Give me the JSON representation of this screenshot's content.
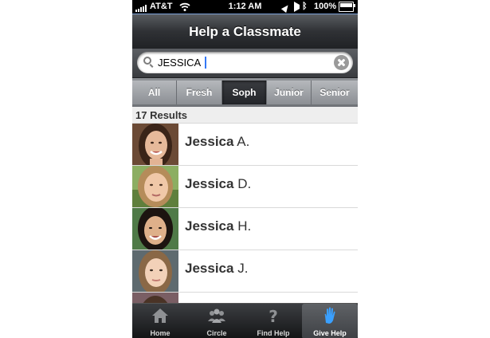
{
  "status_bar": {
    "carrier": "AT&T",
    "time": "1:12 AM",
    "battery_percent": "100%",
    "battery_level": 1.0
  },
  "nav": {
    "title": "Help a Classmate"
  },
  "search": {
    "value": "JESSICA",
    "placeholder": ""
  },
  "filters": [
    {
      "label": "All",
      "active": false
    },
    {
      "label": "Fresh",
      "active": false
    },
    {
      "label": "Soph",
      "active": true
    },
    {
      "label": "Junior",
      "active": false
    },
    {
      "label": "Senior",
      "active": false
    }
  ],
  "results": {
    "count_label": "17 Results",
    "items": [
      {
        "first": "Jessica",
        "last": "A."
      },
      {
        "first": "Jessica",
        "last": "D."
      },
      {
        "first": "Jessica",
        "last": "H."
      },
      {
        "first": "Jessica",
        "last": "J."
      }
    ]
  },
  "tabs": [
    {
      "label": "Home",
      "icon": "home-icon",
      "active": false
    },
    {
      "label": "Circle",
      "icon": "people-icon",
      "active": false
    },
    {
      "label": "Find Help",
      "icon": "question-icon",
      "active": false
    },
    {
      "label": "Give Help",
      "icon": "raised-hand-icon",
      "active": true
    }
  ],
  "colors": {
    "accent_blue": "#3478f6",
    "hand_icon": "#3aa0ff",
    "nav_dark": "#2f3135"
  }
}
